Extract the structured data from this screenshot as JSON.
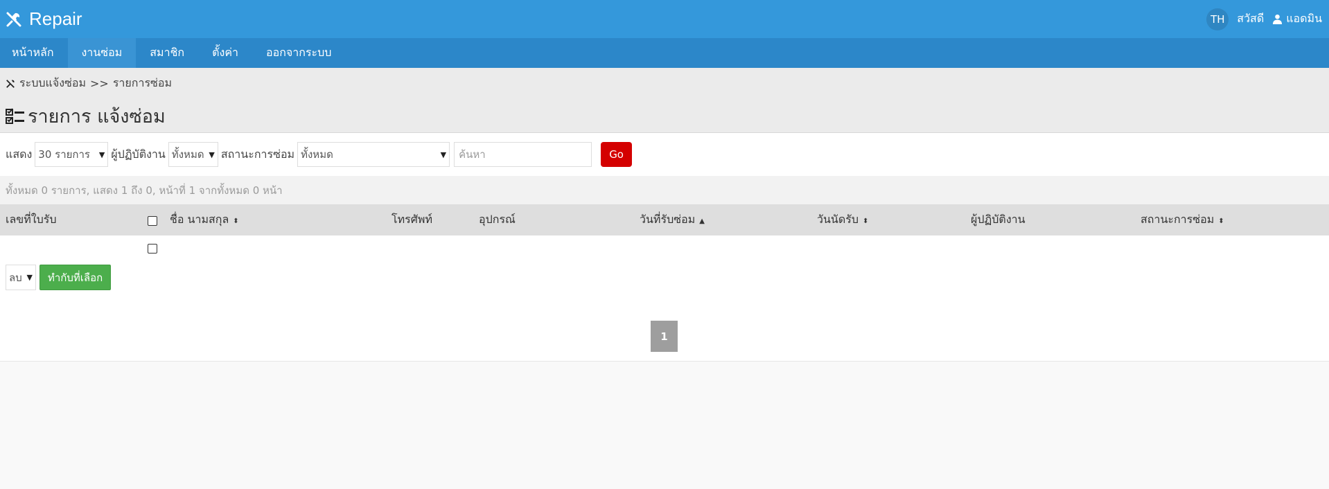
{
  "app": {
    "name": "Repair",
    "lang": "TH",
    "greeting": "สวัสดี",
    "username": "แอดมิน",
    "colors": {
      "header": "#3498db",
      "menu": "#2c87c9",
      "go": "#d40000",
      "apply": "#4cae4c"
    }
  },
  "menu": {
    "items": [
      {
        "label": "หน้าหลัก"
      },
      {
        "label": "งานซ่อม"
      },
      {
        "label": "สมาชิก"
      },
      {
        "label": "ตั้งค่า"
      },
      {
        "label": "ออกจากระบบ"
      }
    ]
  },
  "breadcrumb": {
    "root": "ระบบแจ้งซ่อม",
    "separator": ">>",
    "current": "รายการซ่อม"
  },
  "page": {
    "title": "รายการ แจ้งซ่อม"
  },
  "filters": {
    "show_label": "แสดง",
    "show_value": "30 รายการ",
    "operator_label": "ผู้ปฏิบัติงาน",
    "operator_value": "ทั้งหมด",
    "status_label": "สถานะการซ่อม",
    "status_value": "ทั้งหมด",
    "search_placeholder": "ค้นหา",
    "go_label": "Go"
  },
  "summary": "ทั้งหมด 0 รายการ, แสดง 1 ถึง 0, หน้าที่ 1 จากทั้งหมด 0 หน้า",
  "table": {
    "columns": [
      "เลขที่ใบรับ",
      "ชื่อ นามสกุล",
      "โทรศัพท์",
      "อุปกรณ์",
      "วันที่รับซ่อม",
      "วันนัดรับ",
      "ผู้ปฏิบัติงาน",
      "สถานะการซ่อม"
    ]
  },
  "actions": {
    "action_value": "ลบ",
    "apply_label": "ทำกับที่เลือก"
  },
  "pagination": {
    "current_page": "1"
  }
}
